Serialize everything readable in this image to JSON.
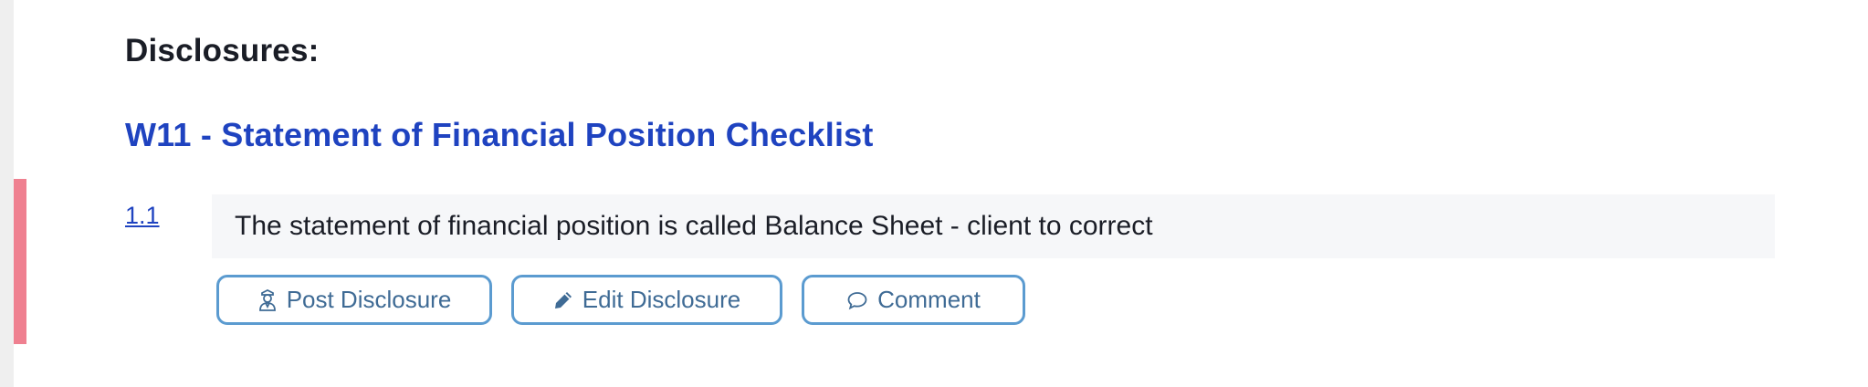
{
  "section": {
    "heading": "Disclosures:"
  },
  "checklist": {
    "title": "W11 - Statement of Financial Position Checklist"
  },
  "item": {
    "number": "1.1",
    "text": "The statement of financial position is called Balance Sheet - client to correct"
  },
  "actions": {
    "post_label": "Post Disclosure",
    "edit_label": "Edit Disclosure",
    "comment_label": "Comment"
  },
  "icons": {
    "post": "user-icon",
    "edit": "pencil-icon",
    "comment": "speech-bubble-icon"
  },
  "colors": {
    "title_blue": "#1f43c0",
    "button_border": "#5b9bd0",
    "button_text": "#3f6b95",
    "marker": "#ef8090",
    "item_background": "#f6f7f9"
  }
}
